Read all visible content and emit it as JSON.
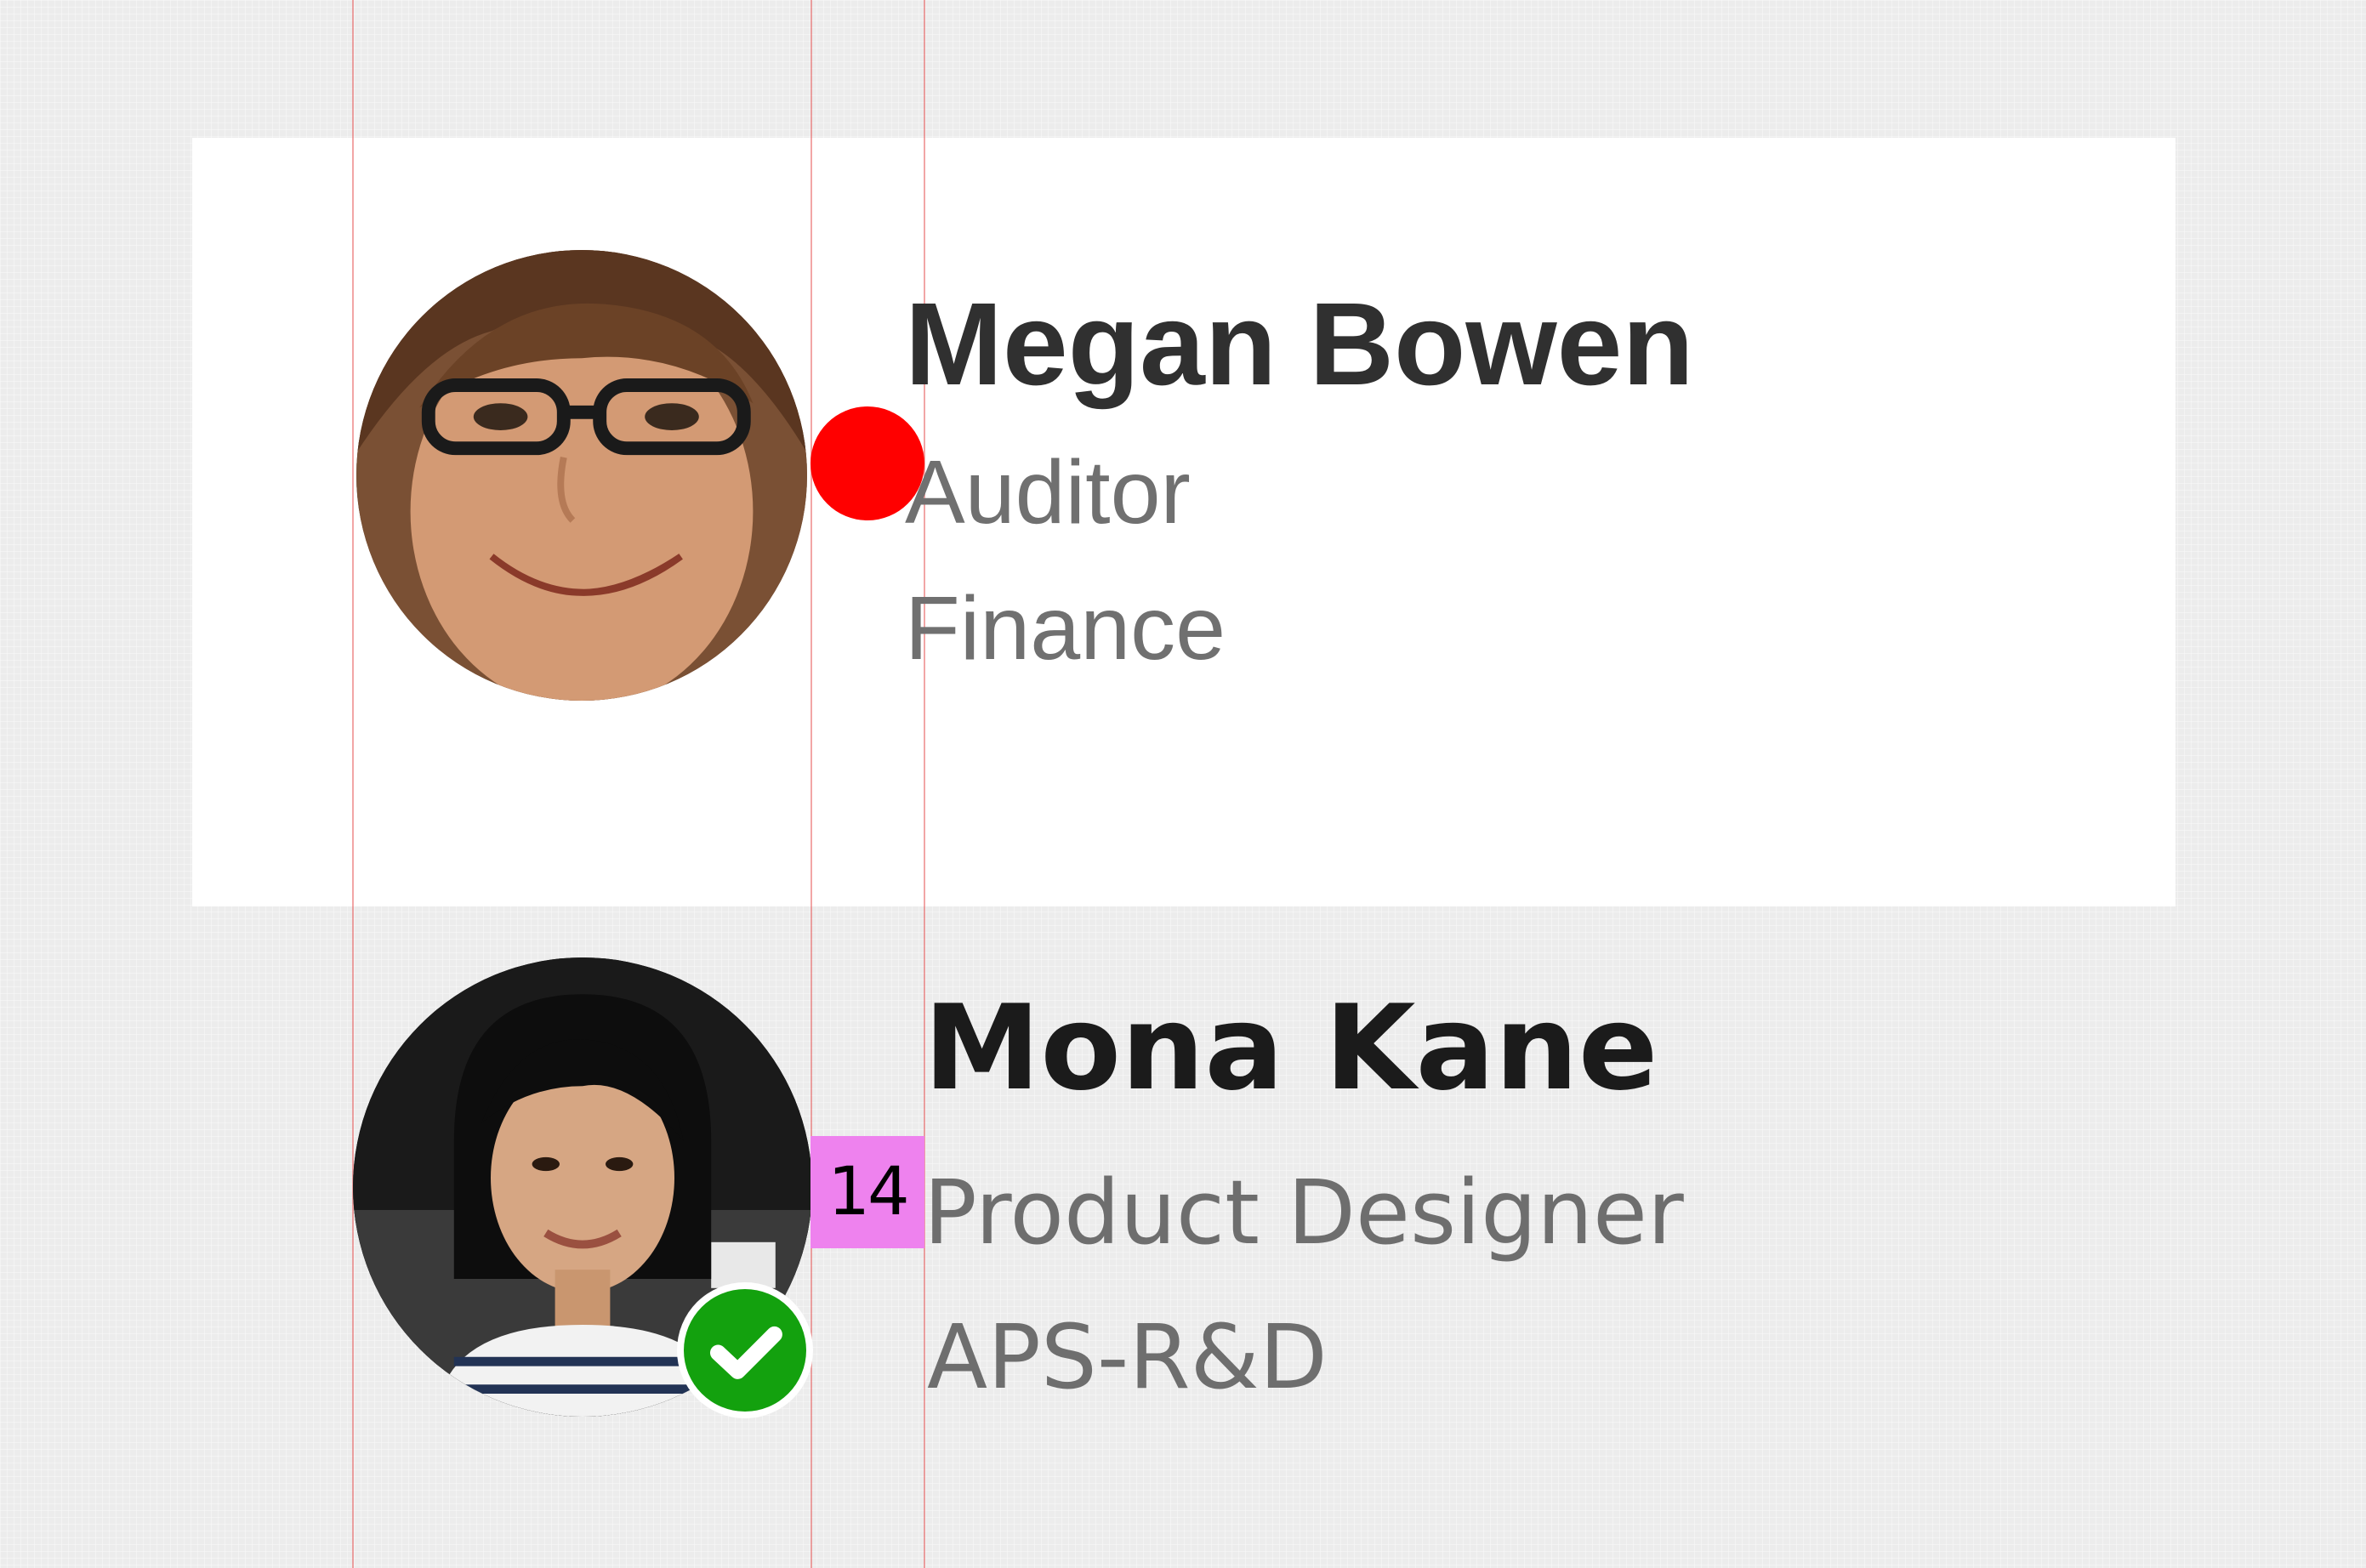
{
  "persona_1": {
    "name": "Megan Bowen",
    "role": "Auditor",
    "department": "Finance",
    "avatar": "avatar-photo-megan",
    "presence_color": "#ff0000"
  },
  "persona_2": {
    "name": "Mona Kane",
    "role": "Product Designer",
    "department": "APS-R&D",
    "avatar": "avatar-photo-mona",
    "presence_icon": "checkmark-icon",
    "presence_color": "#13a10e"
  },
  "spacing_label": "14",
  "colors": {
    "background": "#ececec",
    "panel": "#ffffff",
    "guide_line": "#e85c5c",
    "measure_highlight": "#ee82ee"
  }
}
